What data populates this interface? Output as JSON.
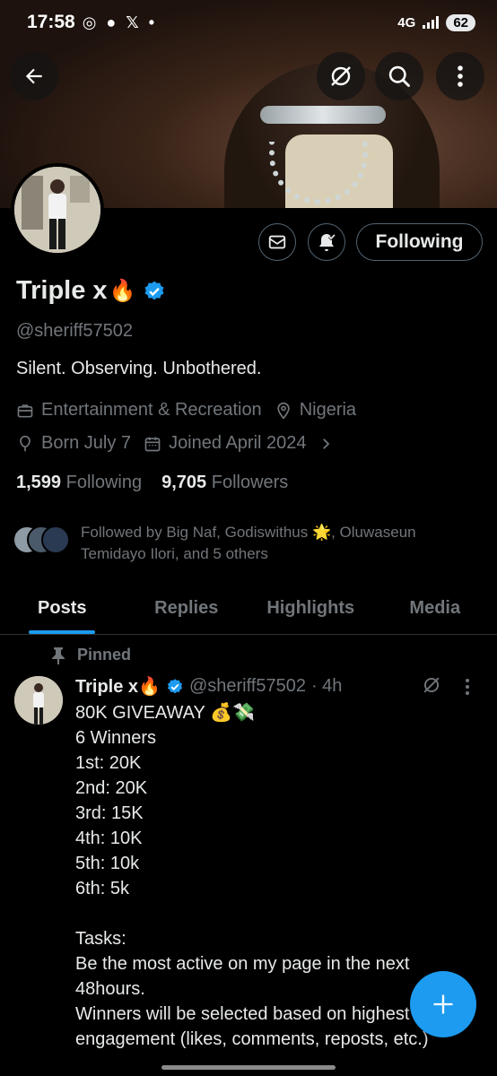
{
  "status_bar": {
    "time": "17:58",
    "app_icons": "◎ ● 𝕏 •",
    "network": "4G",
    "battery": "62"
  },
  "header": {
    "back_icon": "arrow-left-icon",
    "grok_icon": "grok-icon",
    "search_icon": "search-icon",
    "more_icon": "more-vertical-icon"
  },
  "profile": {
    "display_name": "Triple x",
    "name_emoji": "🔥",
    "verified": true,
    "handle": "@sheriff57502",
    "bio": "Silent. Observing. Unbothered.",
    "category": "Entertainment & Recreation",
    "location": "Nigeria",
    "birthday": "Born July 7",
    "joined": "Joined April 2024",
    "following_count": "1,599",
    "following_label": "Following",
    "followers_count": "9,705",
    "followers_label": "Followers",
    "followed_by": "Followed by Big Naf, Godiswithus 🌟, Oluwaseun Temidayo Ilori, and 5 others"
  },
  "actions": {
    "follow_label": "Following"
  },
  "tabs": [
    {
      "label": "Posts",
      "active": true
    },
    {
      "label": "Replies",
      "active": false
    },
    {
      "label": "Highlights",
      "active": false
    },
    {
      "label": "Media",
      "active": false
    }
  ],
  "pinned_post": {
    "pinned_label": "Pinned",
    "name": "Triple x🔥",
    "handle": "@sheriff57502",
    "time": "· 4h",
    "body": "80K GIVEAWAY 💰💸\n6 Winners\n1st: 20K\n2nd: 20K\n3rd: 15K\n4th: 10K\n5th: 10k\n6th: 5k\n\nTasks:\nBe the most active on my page in the next 48hours.\nWinners will be selected based on highest engagement (likes, comments, reposts, etc.)"
  },
  "fab": {
    "icon": "plus-icon"
  },
  "colors": {
    "accent": "#1d9bf0",
    "background": "#000000",
    "text_primary": "#e7e9ea",
    "text_secondary": "#71767b",
    "border": "#2f3336"
  }
}
